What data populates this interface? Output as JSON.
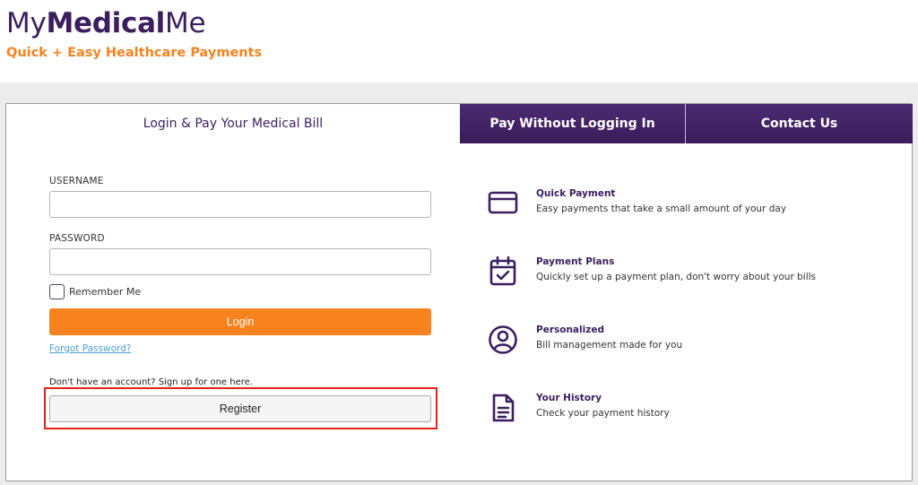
{
  "brand": {
    "name_part1": "My",
    "name_part2": "Medical",
    "name_part3": "Me",
    "tagline": "Quick + Easy Healthcare Payments",
    "primary_color": "#3b1e5e",
    "accent_color": "#f7821e"
  },
  "tabs": [
    {
      "label": "Login & Pay Your Medical Bill",
      "active": true
    },
    {
      "label": "Pay Without Logging In",
      "active": false
    },
    {
      "label": "Contact Us",
      "active": false
    }
  ],
  "login_form": {
    "username_label": "USERNAME",
    "username_value": "",
    "password_label": "PASSWORD",
    "password_value": "",
    "remember_label": "Remember Me",
    "remember_checked": false,
    "login_button": "Login",
    "forgot_link": "Forgot Password?",
    "signup_prompt": "Don't have an account? Sign up for one here.",
    "register_button": "Register"
  },
  "features": [
    {
      "title": "Quick Payment",
      "description": "Easy payments that take a small amount of your day",
      "icon": "credit-card-icon"
    },
    {
      "title": "Payment Plans",
      "description": "Quickly set up a payment plan, don't worry about your bills",
      "icon": "calendar-check-icon"
    },
    {
      "title": "Personalized",
      "description": "Bill management made for you",
      "icon": "user-circle-icon"
    },
    {
      "title": "Your History",
      "description": "Check your payment history",
      "icon": "document-icon"
    }
  ]
}
